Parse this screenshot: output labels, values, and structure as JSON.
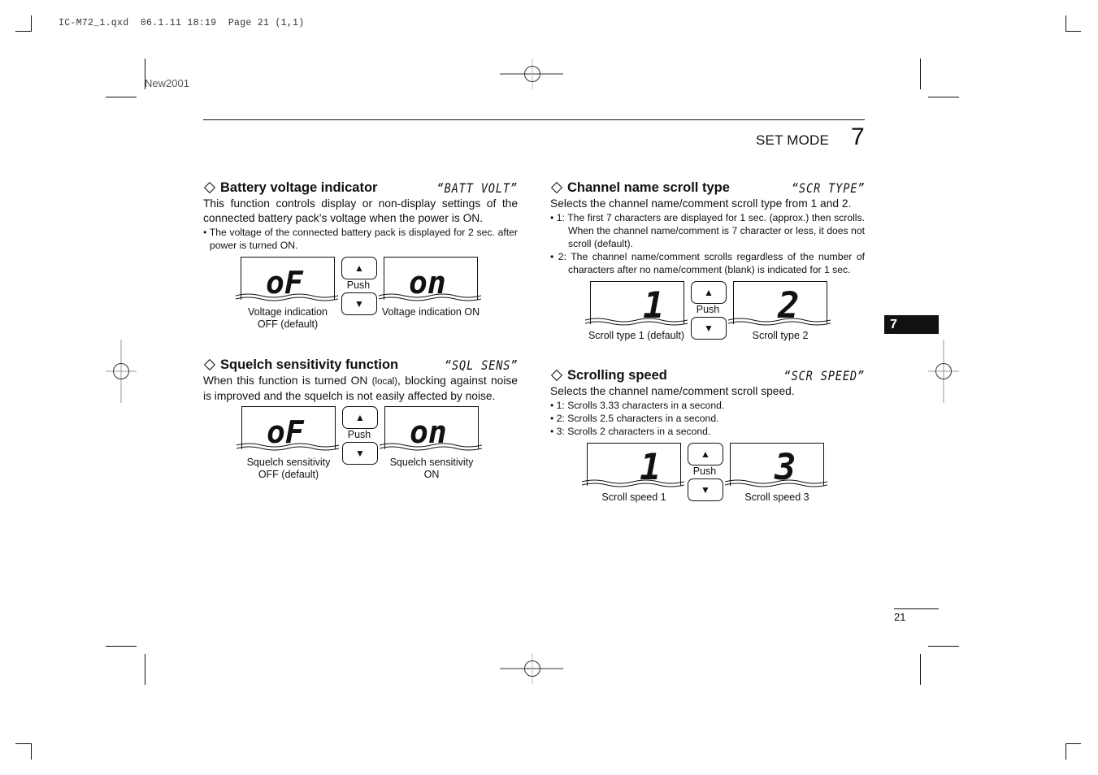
{
  "print_slug": "IC-M72_1.qxd  06.1.11 18:19  Page 21 (1,1)",
  "marker": "New2001",
  "header": {
    "section_label": "SET MODE",
    "chapter_number": "7"
  },
  "side_tab": "7",
  "page_number": "21",
  "icons": {
    "diamond": "diamond-bullet-icon",
    "up": "up-arrow-icon",
    "down": "down-arrow-icon",
    "registration": "registration-mark-icon",
    "crop": "crop-mark-icon"
  },
  "sections": {
    "battery": {
      "title": "Battery voltage indicator",
      "lcd_code": "“BATT VOLT”",
      "description": "This function controls display or non-display settings of the connected battery pack’s voltage when the power is ON.",
      "bullets": [
        "• The voltage of the connected battery pack is displayed for 2 sec. after power is turned ON."
      ],
      "diagram": {
        "left_display": "oF",
        "right_display": "on",
        "push_label": "Push",
        "left_caption_1": "Voltage indication",
        "left_caption_2": "OFF (default)",
        "right_caption_1": "Voltage indication ON"
      }
    },
    "squelch": {
      "title": "Squelch sensitivity function",
      "lcd_code": "“SQL SENS”",
      "description_1": "When this function is turned ON ",
      "description_small": "(local)",
      "description_2": ", blocking against noise is improved and the squelch is not easily affected by noise.",
      "diagram": {
        "left_display": "oF",
        "right_display": "on",
        "push_label": "Push",
        "left_caption_1": "Squelch sensitivity",
        "left_caption_2": "OFF (default)",
        "right_caption_1": "Squelch sensitivity",
        "right_caption_2": "ON"
      }
    },
    "scroll_type": {
      "title": "Channel name scroll type",
      "lcd_code": "“SCR TYPE”",
      "description": "Selects the channel name/comment scroll type from 1 and 2.",
      "bullets": [
        "• 1: The first 7 characters are displayed for 1 sec. (approx.) then scrolls. When the channel name/comment is 7 character or less, it does  not scroll (default).",
        "• 2: The channel name/comment scrolls regardless of the number of characters after no name/comment (blank) is indicated for 1 sec."
      ],
      "diagram": {
        "left_display": "1",
        "right_display": "2",
        "push_label": "Push",
        "left_caption_1": "Scroll type 1 (default)",
        "right_caption_1": "Scroll type 2"
      }
    },
    "scroll_speed": {
      "title": "Scrolling speed",
      "lcd_code": "“SCR SPEED”",
      "description": "Selects the channel name/comment scroll speed.",
      "bullets": [
        "• 1: Scrolls 3.33 characters in a second.",
        "• 2: Scrolls 2.5 characters in a second.",
        "• 3: Scrolls 2 characters in a second."
      ],
      "diagram": {
        "left_display": "1",
        "right_display": "3",
        "push_label": "Push",
        "left_caption_1": "Scroll speed 1",
        "right_caption_1": "Scroll speed 3"
      }
    }
  }
}
